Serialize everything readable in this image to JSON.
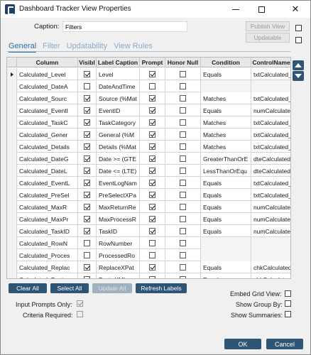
{
  "window": {
    "title": "Dashboard Tracker View Properties",
    "minimize": "—",
    "close": "✕"
  },
  "caption": {
    "label": "Caption:",
    "value": "Filters"
  },
  "top_buttons": {
    "publish": "Publish View",
    "updatable": "Updatable"
  },
  "tabs": [
    "General",
    "Filter",
    "Updatability",
    "View Rules"
  ],
  "columns": [
    "Column",
    "Visibl",
    "Label Caption",
    "Prompt",
    "Honor Null",
    "Condition",
    "ControlName"
  ],
  "rows": [
    {
      "column": "Calculated_Level",
      "visible": true,
      "label": "Level",
      "prompt": true,
      "honor": false,
      "condition": "Equals",
      "control": "txtCalculated_L",
      "current": true
    },
    {
      "column": "Calculated_DateA",
      "visible": false,
      "label": "DateAndTime",
      "prompt": false,
      "honor": false,
      "condition": "",
      "control": ""
    },
    {
      "column": "Calculated_Sourc",
      "visible": true,
      "label": "Source (%Mat",
      "prompt": true,
      "honor": false,
      "condition": "Matches",
      "control": "txtCalculated_"
    },
    {
      "column": "Calculated_EventI",
      "visible": true,
      "label": "EventID",
      "prompt": true,
      "honor": false,
      "condition": "Equals",
      "control": "numCalculated"
    },
    {
      "column": "Calculated_TaskC",
      "visible": true,
      "label": "TaskCategory",
      "prompt": true,
      "honor": false,
      "condition": "Matches",
      "control": "txtCalculated_T"
    },
    {
      "column": "Calculated_Gener",
      "visible": true,
      "label": "General (%M",
      "prompt": true,
      "honor": false,
      "condition": "Matches",
      "control": "txtCalculated_"
    },
    {
      "column": "Calculated_Details",
      "visible": true,
      "label": "Details (%Mat",
      "prompt": true,
      "honor": false,
      "condition": "Matches",
      "control": "txtCalculated_"
    },
    {
      "column": "Calculated_DateG",
      "visible": true,
      "label": "Date >= (GTE",
      "prompt": true,
      "honor": false,
      "condition": "GreaterThanOrE",
      "control": "dteCalculated_"
    },
    {
      "column": "Calculated_DateL",
      "visible": true,
      "label": "Date <= (LTE)",
      "prompt": true,
      "honor": false,
      "condition": "LessThanOrEqu",
      "control": "dteCalculated_"
    },
    {
      "column": "Calculated_EventL",
      "visible": true,
      "label": "EventLogNam",
      "prompt": true,
      "honor": false,
      "condition": "Equals",
      "control": "txtCalculated_"
    },
    {
      "column": "Calculated_PreSel",
      "visible": true,
      "label": "PreSelectXPa",
      "prompt": true,
      "honor": false,
      "condition": "Equals",
      "control": "txtCalculated_"
    },
    {
      "column": "Calculated_MaxR",
      "visible": true,
      "label": "MaxReturnRe",
      "prompt": true,
      "honor": false,
      "condition": "Equals",
      "control": "numCalculated"
    },
    {
      "column": "Calculated_MaxPr",
      "visible": true,
      "label": "MaxProcessR",
      "prompt": true,
      "honor": false,
      "condition": "Equals",
      "control": "numCalculated"
    },
    {
      "column": "Calculated_TaskID",
      "visible": true,
      "label": "TaskID",
      "prompt": true,
      "honor": false,
      "condition": "Equals",
      "control": "numCalculated"
    },
    {
      "column": "Calculated_RowN",
      "visible": false,
      "label": "RowNumber",
      "prompt": false,
      "honor": false,
      "condition": "",
      "control": ""
    },
    {
      "column": "Calculated_Proces",
      "visible": false,
      "label": "ProcessedRo",
      "prompt": false,
      "honor": false,
      "condition": "",
      "control": ""
    },
    {
      "column": "Calculated_Replac",
      "visible": true,
      "label": "ReplaceXPat",
      "prompt": true,
      "honor": false,
      "condition": "Equals",
      "control": "chkCalculated_"
    },
    {
      "column": "Calculated_Pretty",
      "visible": true,
      "label": "PrettyXML",
      "prompt": true,
      "honor": false,
      "condition": "Equals",
      "control": "chkCalculated_"
    }
  ],
  "bottom_buttons": {
    "clear_all": "Clear All",
    "select_all": "Select All",
    "update_all": "Update All",
    "refresh_labels": "Refresh Labels"
  },
  "options": {
    "embed_grid": {
      "label": "Embed Grid View:",
      "checked": false
    },
    "input_prompts": {
      "label": "Input Prompts Only:",
      "checked": true,
      "disabled": true
    },
    "show_group_by": {
      "label": "Show Group By:",
      "checked": false
    },
    "criteria_required": {
      "label": "Criteria Required:",
      "checked": false,
      "disabled": true
    },
    "show_summaries": {
      "label": "Show Summaries:",
      "checked": false
    }
  },
  "footer": {
    "ok": "OK",
    "cancel": "Cancel"
  },
  "colors": {
    "accent": "#2f5576",
    "tab_active": "#2c6da6"
  }
}
